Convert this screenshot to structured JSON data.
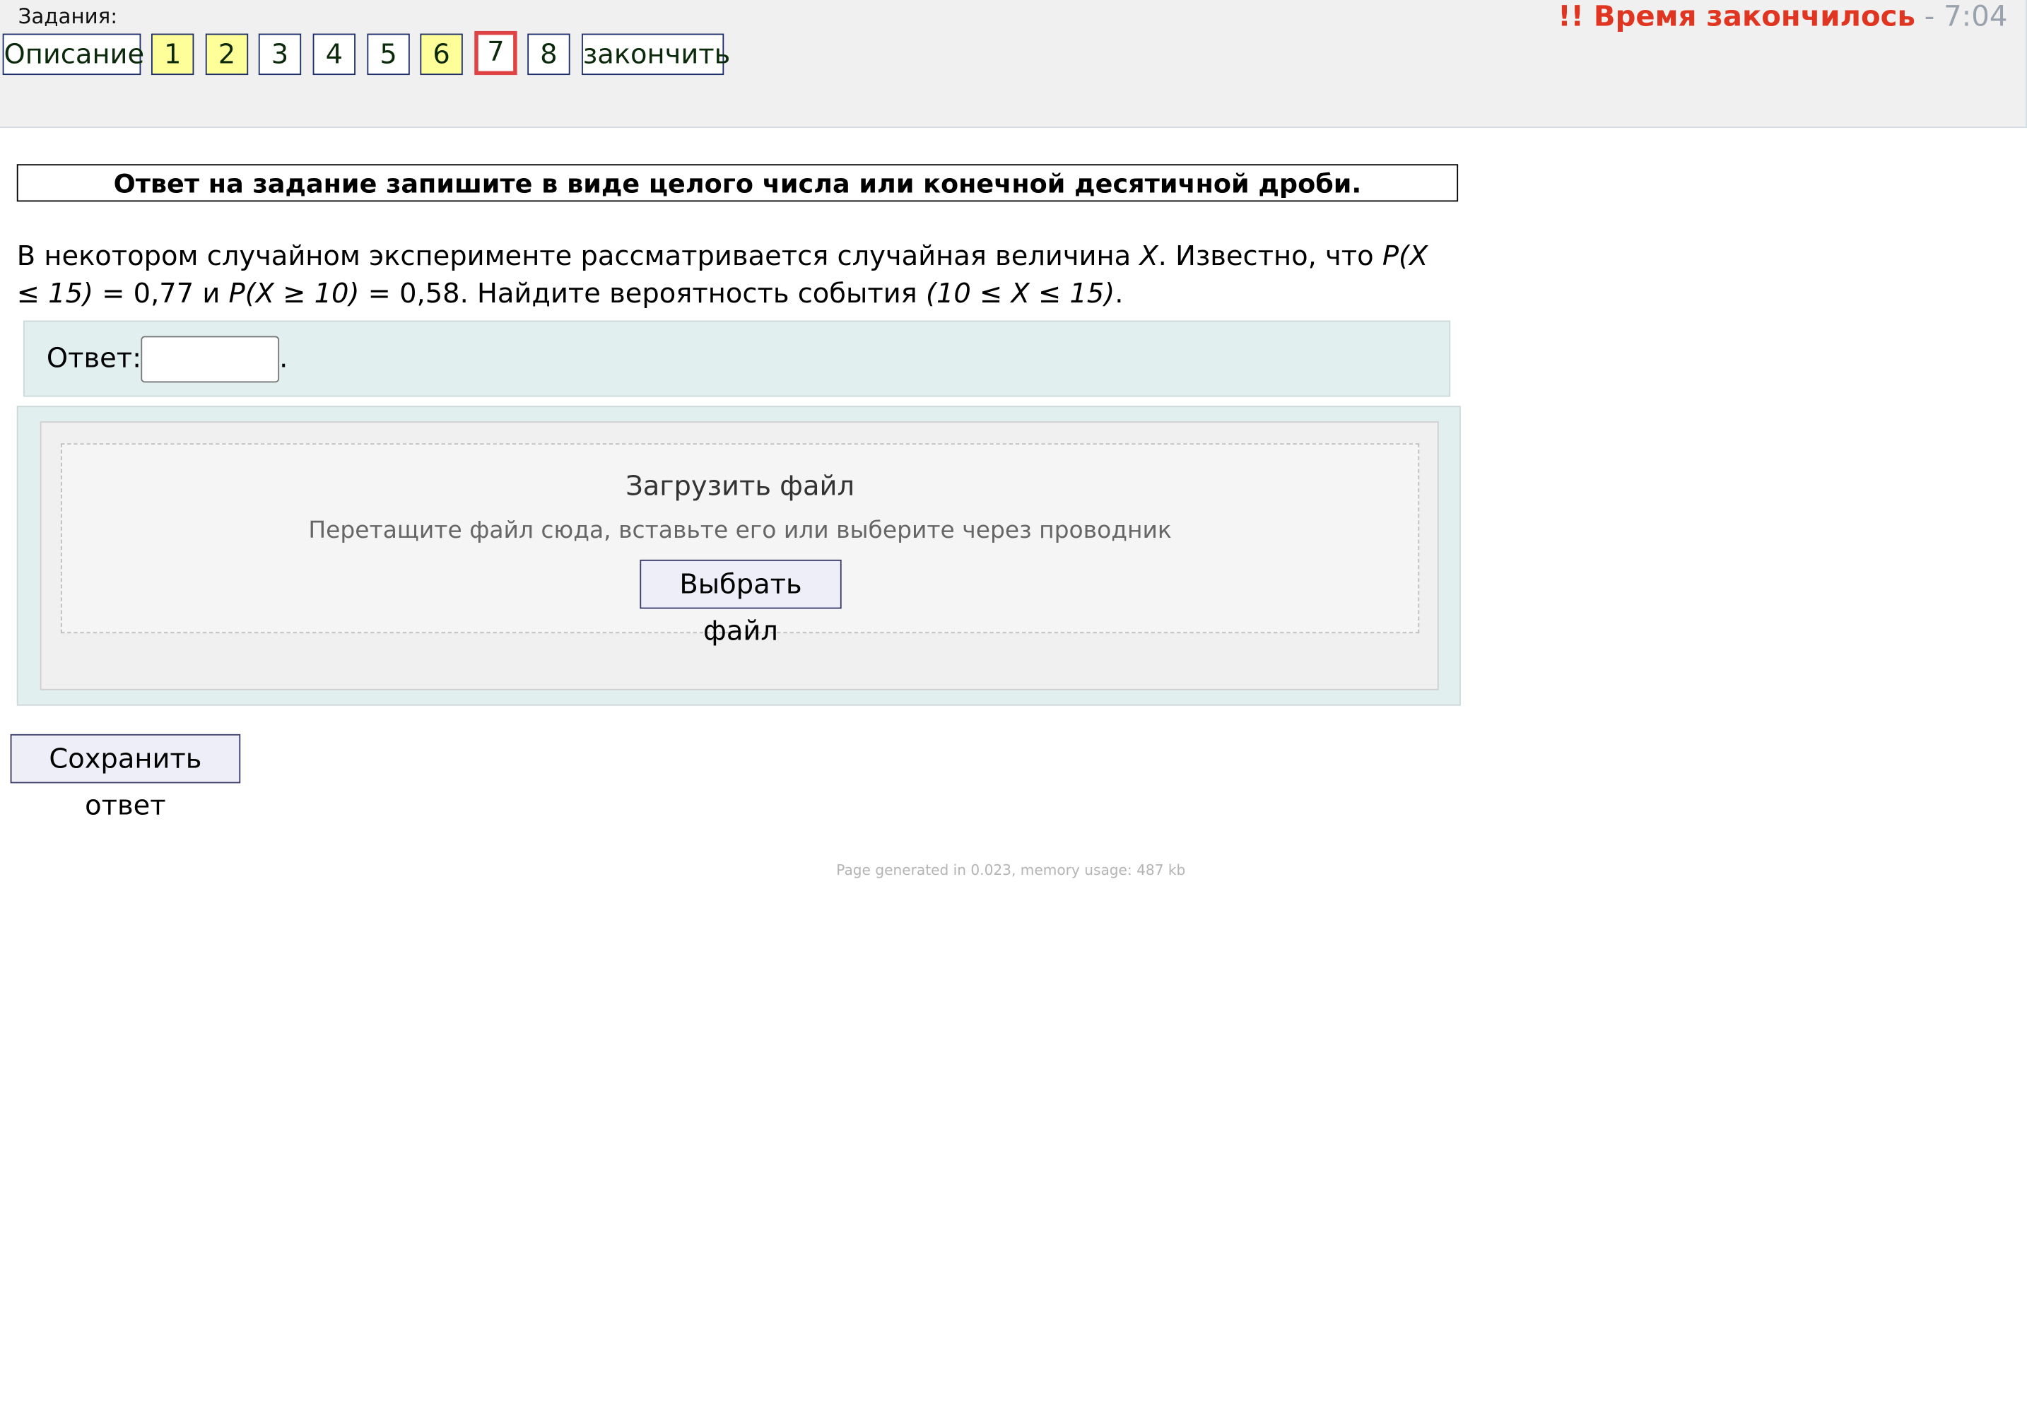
{
  "header": {
    "tasks_label": "Задания:",
    "nav": [
      {
        "label": "Описание",
        "state": "normal"
      },
      {
        "label": "1",
        "state": "done"
      },
      {
        "label": "2",
        "state": "done"
      },
      {
        "label": "3",
        "state": "normal"
      },
      {
        "label": "4",
        "state": "normal"
      },
      {
        "label": "5",
        "state": "normal"
      },
      {
        "label": "6",
        "state": "done"
      },
      {
        "label": "7",
        "state": "current"
      },
      {
        "label": "8",
        "state": "normal"
      },
      {
        "label": "закончить",
        "state": "normal"
      }
    ],
    "timer": {
      "alert": "!! Время закончилось",
      "separator": " - ",
      "time": "7:04"
    }
  },
  "task": {
    "instruction": "Ответ на задание запишите в виде целого числа или конечной десятичной дроби.",
    "question_parts": [
      {
        "text": "В некотором случайном эксперименте рассматривается случайная величина ",
        "italic": false
      },
      {
        "text": "X",
        "italic": true
      },
      {
        "text": ". Известно, что ",
        "italic": false
      },
      {
        "text": "P(X ≤ 15)",
        "italic": true
      },
      {
        "text": " = 0,77 и ",
        "italic": false
      },
      {
        "text": "P(X ≥ 10)",
        "italic": true
      },
      {
        "text": " = 0,58. Найдите вероятность события ",
        "italic": false
      },
      {
        "text": "(10 ≤ X ≤ 15)",
        "italic": true
      },
      {
        "text": ".",
        "italic": false
      }
    ],
    "answer": {
      "label": "Ответ:",
      "value": "",
      "suffix": "."
    }
  },
  "upload": {
    "title": "Загрузить файл",
    "hint": "Перетащите файл сюда, вставьте его или выберите через проводник",
    "button_label": "Выбрать файл"
  },
  "actions": {
    "save_label": "Сохранить ответ"
  },
  "footer": {
    "text": "Page generated in 0.023, memory usage: 487 kb"
  },
  "colors": {
    "done_bg": "#ffff9a",
    "current_border": "#e04343",
    "timer_alert": "#e03520",
    "panel_bg": "#e2efef"
  }
}
